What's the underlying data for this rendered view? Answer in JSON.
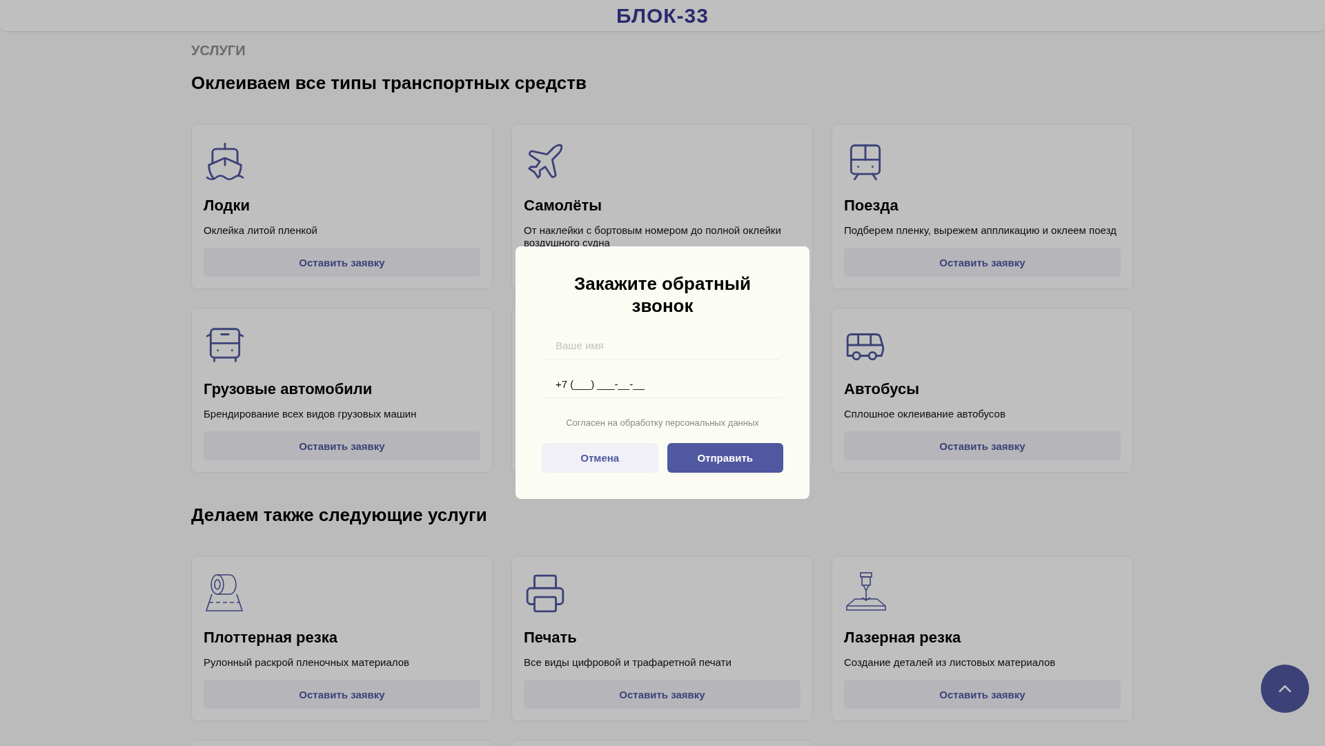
{
  "header": {
    "logo": "БЛОК-33"
  },
  "sections": [
    {
      "eyebrow": "УСЛУГИ",
      "title": "Оклеиваем все типы транспортных средств",
      "cards": [
        {
          "kind": "service",
          "title": "Лодки",
          "description": "Оклейка литой пленкой",
          "button": "Оставить заявку"
        },
        {
          "kind": "service",
          "title": "Самолёты",
          "description": "От наклейки с бортовым номером до полной оклейки воздушного судна"
        },
        {
          "kind": "service",
          "title": "Поезда",
          "description": "Подберем пленку, вырежем аппликацию и оклеем поезд",
          "button": "Оставить заявку"
        },
        {
          "kind": "service",
          "title": "Грузовые автомобили",
          "description": "Брендирование всех видов грузовых машин",
          "button": "Оставить заявку"
        },
        {
          "kind": "covered"
        },
        {
          "kind": "service",
          "title": "Автобусы",
          "description": "Сплошное оклеивание автобусов",
          "button": "Оставить заявку"
        }
      ]
    },
    {
      "title": "Делаем также следующие услуги",
      "cards": [
        {
          "kind": "service",
          "title": "Плоттерная резка",
          "description": "Рулонный раскрой пленочных материалов",
          "button": "Оставить заявку"
        },
        {
          "kind": "service",
          "title": "Печать",
          "description": "Все виды цифровой и трафаретной печати",
          "button": "Оставить заявку"
        },
        {
          "kind": "service",
          "title": "Лазерная резка",
          "description": "Создание деталей из листовых материалов",
          "button": "Оставить заявку"
        },
        {
          "kind": "covered"
        },
        {
          "kind": "covered"
        }
      ]
    }
  ],
  "modal": {
    "title": "Закажите обратный звонок",
    "fields": [
      {
        "placeholder": "Ваше имя"
      },
      {
        "value": "+7 (___) ___-__-__"
      }
    ],
    "consent": "Согласен на обработку персональных данных",
    "buttons": [
      {
        "label": "Отмена",
        "kind": "secondary"
      },
      {
        "label": "Отправить",
        "kind": "primary"
      }
    ]
  }
}
